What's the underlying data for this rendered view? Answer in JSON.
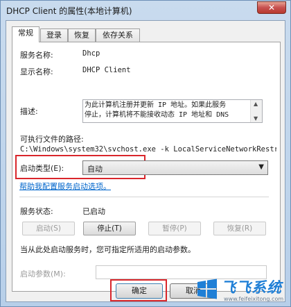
{
  "window": {
    "title": "DHCP Client 的属性(本地计算机)",
    "close_glyph": "✕"
  },
  "tabs": [
    {
      "label": "常规",
      "active": true
    },
    {
      "label": "登录",
      "active": false
    },
    {
      "label": "恢复",
      "active": false
    },
    {
      "label": "依存关系",
      "active": false
    }
  ],
  "general": {
    "service_name_label": "服务名称:",
    "service_name_value": "Dhcp",
    "display_name_label": "显示名称:",
    "display_name_value": "DHCP Client",
    "description_label": "描述:",
    "description_lines": [
      "为此计算机注册并更新 IP 地址。如果此服务",
      "停止，计算机将不能接收动态 IP 地址和 DNS"
    ],
    "exe_path_label": "可执行文件的路径:",
    "exe_path_value": "C:\\Windows\\system32\\svchost.exe -k LocalServiceNetworkRestri",
    "startup_type_label": "启动类型(E):",
    "startup_type_value": "自动",
    "help_link": "帮助我配置服务启动选项。",
    "status_label": "服务状态:",
    "status_value": "已启动",
    "start_button": "启动(S)",
    "stop_button": "停止(T)",
    "pause_button": "暂停(P)",
    "resume_button": "恢复(R)",
    "hint": "当从此处启动服务时，您可指定所适用的启动参数。",
    "params_label": "启动参数(M):",
    "params_value": ""
  },
  "footer": {
    "ok_button": "确定",
    "cancel_button": "取消"
  },
  "watermark": {
    "brand": "飞飞系统",
    "url": "www.feifeixitong.com"
  },
  "colors": {
    "highlight": "#d9262b",
    "link": "#0066cc"
  }
}
